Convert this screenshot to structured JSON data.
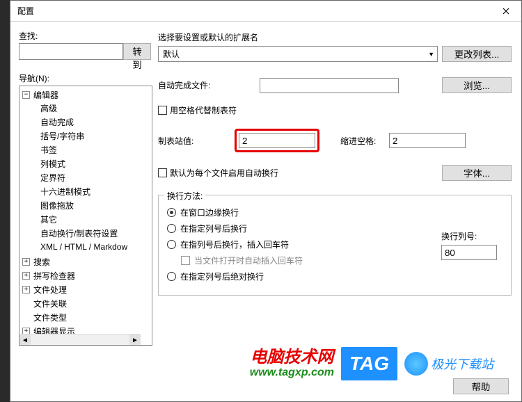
{
  "title": "配置",
  "search": {
    "label": "查找:",
    "value": "",
    "goto": "转到"
  },
  "nav": {
    "label": "导航(N):",
    "tree": {
      "root": "编辑器",
      "children": [
        "高级",
        "自动完成",
        "括号/字符串",
        "书签",
        "列模式",
        "定界符",
        "十六进制模式",
        "图像拖放",
        "其它",
        "自动换行/制表符设置",
        "XML / HTML / Markdow"
      ],
      "siblings": [
        "搜索",
        "拼写检查器",
        "文件处理",
        "文件关联",
        "文件类型",
        "编辑器显示"
      ]
    }
  },
  "right": {
    "ext_label": "选择要设置或默认的扩展名",
    "combo_value": "默认",
    "change_list": "更改列表...",
    "autocomplete_file": "自动完成文件:",
    "autocomplete_value": "",
    "browse": "浏览...",
    "use_spaces": "用空格代替制表符",
    "tab_stop_label": "制表站值:",
    "tab_stop_value": "2",
    "indent_spaces_label": "缩进空格:",
    "indent_spaces_value": "2",
    "default_wrap": "默认为每个文件启用自动换行",
    "font_btn": "字体...",
    "wrap": {
      "legend": "换行方法:",
      "o1": "在窗口边缘换行",
      "o2": "在指定列号后换行",
      "o3": "在指列号后换行，插入回车符",
      "o3_sub": "当文件打开时自动插入回车符",
      "o4": "在指定列号后绝对换行",
      "col_label": "换行列号:",
      "col_value": "80"
    }
  },
  "footer": {
    "help": "帮助"
  },
  "watermark": {
    "line1": "电脑技术网",
    "url": "www.tagxp.com",
    "tag": "TAG",
    "jg": "极光下载站"
  }
}
